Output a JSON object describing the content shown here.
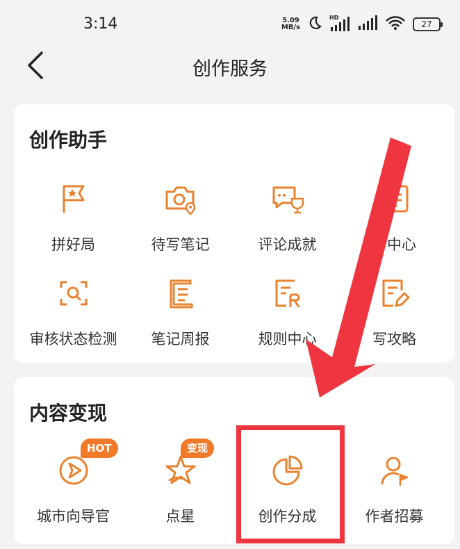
{
  "status_bar": {
    "time": "3:14",
    "net_speed_value": "5.09",
    "net_speed_unit": "MB/s",
    "hd_label": "HD",
    "battery": "27"
  },
  "nav": {
    "title": "创作服务",
    "back_icon": "chevron-left-icon"
  },
  "creation_assistant": {
    "title": "创作助手",
    "items": [
      {
        "label": "拼好局",
        "icon": "flag-star-icon"
      },
      {
        "label": "待写笔记",
        "icon": "camera-location-icon"
      },
      {
        "label": "评论成就",
        "icon": "comment-trophy-icon"
      },
      {
        "label": "务中心",
        "icon": "task-list-icon"
      },
      {
        "label": "审核状态检测",
        "icon": "scan-search-icon"
      },
      {
        "label": "笔记周报",
        "icon": "scroll-note-icon"
      },
      {
        "label": "规则中心",
        "icon": "rules-document-icon"
      },
      {
        "label": "写攻略",
        "icon": "edit-document-icon"
      }
    ]
  },
  "monetization": {
    "title": "内容变现",
    "items": [
      {
        "label": "城市向导官",
        "icon": "compass-play-icon",
        "badge": "HOT"
      },
      {
        "label": "点星",
        "icon": "star-icon",
        "badge": "变现"
      },
      {
        "label": "创作分成",
        "icon": "pie-chart-icon"
      },
      {
        "label": "作者招募",
        "icon": "user-flag-icon"
      }
    ]
  },
  "colors": {
    "accent": "#e8822e",
    "badge": "#f07a2a",
    "annotation": "#ee3540"
  }
}
